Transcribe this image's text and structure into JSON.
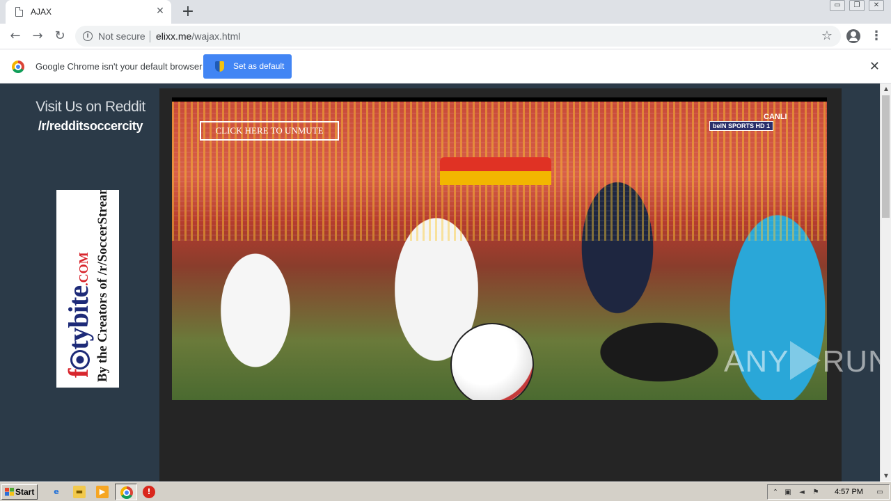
{
  "browser": {
    "tab_title": "AJAX",
    "tab_close": "✕",
    "new_tab": "+",
    "window_controls": [
      "▭",
      "❐",
      "✕"
    ],
    "nav": {
      "back": "←",
      "forward": "→",
      "reload": "↻"
    },
    "omnibox": {
      "security_label": "Not secure",
      "host": "elixx.me",
      "path": "/wajax.html"
    },
    "icons": {
      "bookmark": "star-icon",
      "account": "account-icon",
      "menu": "menu-icon"
    }
  },
  "infobar": {
    "message": "Google Chrome isn't your default browser",
    "button_label": "Set as default",
    "close": "✕"
  },
  "page": {
    "reddit_title": "Visit Us on Reddit",
    "reddit_sub": "/r/redditsoccercity",
    "banner": {
      "brand_f": "f",
      "brand_rest": "tybite",
      "brand_suffix": ".COM",
      "tagline": "By the Creators of /r/SoccerStreams"
    },
    "video": {
      "unmute_label": "CLICK HERE TO UNMUTE",
      "live_label": "CANLI",
      "channel_label": "beIN SPORTS HD 1"
    },
    "watermark": {
      "left": "ANY",
      "right": "RUN"
    }
  },
  "taskbar": {
    "start_label": "Start",
    "clock": "4:57 PM"
  },
  "colors": {
    "page_bg": "#2b3a48",
    "panel_bg": "#252525",
    "chrome_blue": "#4285f4",
    "taskbar": "#d4d0c8"
  }
}
